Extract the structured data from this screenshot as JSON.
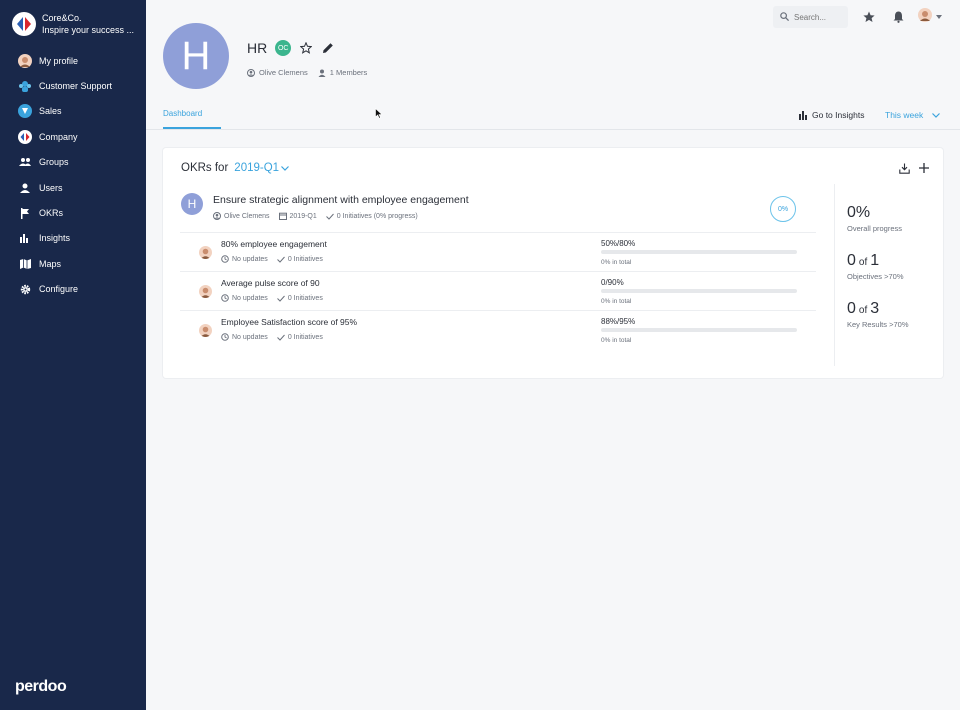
{
  "org": {
    "name": "Core&Co.",
    "tagline": "Inspire your success ..."
  },
  "sidebar": {
    "items": [
      {
        "label": "My profile",
        "icon": "user-avatar-icon"
      },
      {
        "label": "Customer Support",
        "icon": "support-group-icon"
      },
      {
        "label": "Sales",
        "icon": "sales-group-icon"
      },
      {
        "label": "Company",
        "icon": "company-logo-icon"
      },
      {
        "label": "Groups",
        "icon": "groups-icon"
      },
      {
        "label": "Users",
        "icon": "user-icon"
      },
      {
        "label": "OKRs",
        "icon": "flag-icon"
      },
      {
        "label": "Insights",
        "icon": "bar-chart-icon"
      },
      {
        "label": "Maps",
        "icon": "map-icon"
      },
      {
        "label": "Configure",
        "icon": "gear-icon"
      }
    ],
    "brand": "perdoo"
  },
  "topbar": {
    "search_placeholder": "Search..."
  },
  "group": {
    "initial": "H",
    "name": "HR",
    "owner_badge": "OC",
    "owner": "Olive Clemens",
    "members": "1 Members"
  },
  "tabs": {
    "dashboard": "Dashboard"
  },
  "toolbar": {
    "insights_label": "Go to Insights",
    "period": "This week"
  },
  "okr_card": {
    "heading": "OKRs for",
    "quarter": "2019-Q1",
    "objective": {
      "initial": "H",
      "title": "Ensure strategic alignment with employee engagement",
      "owner": "Olive Clemens",
      "quarter": "2019-Q1",
      "initiatives": "0 Initiatives (0% progress)",
      "progress": "0%"
    },
    "key_results": [
      {
        "title": "80% employee engagement",
        "updates": "No updates",
        "initiatives": "0 Initiatives",
        "ratio": "50%/80%",
        "fill": 0,
        "total": "0% in total"
      },
      {
        "title": "Average pulse score of 90",
        "updates": "No updates",
        "initiatives": "0 Initiatives",
        "ratio": "0/90%",
        "fill": 0,
        "total": "0% in total"
      },
      {
        "title": "Employee Satisfaction score of 95%",
        "updates": "No updates",
        "initiatives": "0 Initiatives",
        "ratio": "88%/95%",
        "fill": 0,
        "total": "0% in total"
      }
    ],
    "stats": {
      "overall_value": "0%",
      "overall_label": "Overall progress",
      "objectives_a": "0",
      "objectives_of": "of",
      "objectives_b": "1",
      "objectives_label": "Objectives >70%",
      "krs_a": "0",
      "krs_of": "of",
      "krs_b": "3",
      "krs_label": "Key Results >70%"
    }
  },
  "colors": {
    "sidebar": "#19284a",
    "accent": "#3aa3dd",
    "avatar": "#8f9fd8",
    "badge": "#3bb58e"
  }
}
